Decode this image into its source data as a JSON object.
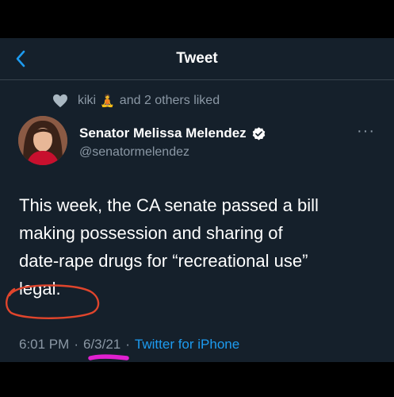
{
  "navbar": {
    "title": "Tweet",
    "back_icon": "chevron-left-icon"
  },
  "social_context": {
    "icon": "heart-icon",
    "user": "kiki",
    "emoji": "🧘",
    "text": "and 2 others liked"
  },
  "tweet": {
    "author_name": "Senator Melissa Melendez",
    "handle": "@senatormelendez",
    "verified": true,
    "more_icon": "ellipsis-icon",
    "more_text": "···",
    "body_lines": [
      "This week, the CA senate passed a bill",
      "making possession and sharing of",
      "date-rape drugs for “recreational use”",
      "legal."
    ],
    "time": "6:01 PM",
    "separator": "·",
    "date": "6/3/21",
    "source": "Twitter for iPhone"
  },
  "colors": {
    "background": "#15202b",
    "text": "#ffffff",
    "secondary": "#8b98a5",
    "accent": "#1d9bf0",
    "circle_annotation": "#e0452c",
    "underline_annotation": "#e020d0"
  },
  "annotations": [
    {
      "type": "hand-drawn-circle",
      "target": "legal."
    },
    {
      "type": "hand-drawn-underline",
      "target": "6/3/21"
    }
  ]
}
